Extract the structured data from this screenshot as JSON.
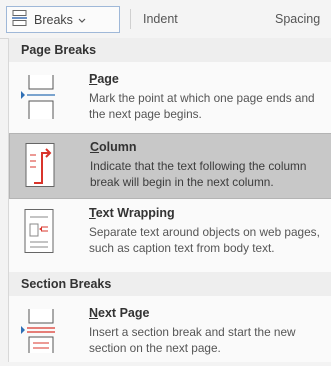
{
  "ribbon": {
    "breaks_label": "Breaks",
    "indent_label": "Indent",
    "spacing_label": "Spacing"
  },
  "menu": {
    "sections": [
      {
        "header": "Page Breaks",
        "items": [
          {
            "icon": "page-break-icon",
            "mnemonic": "P",
            "rest": "age",
            "description": "Mark the point at which one page ends and the next page begins.",
            "selected": false
          },
          {
            "icon": "column-break-icon",
            "mnemonic": "C",
            "rest": "olumn",
            "description": "Indicate that the text following the column break will begin in the next column.",
            "selected": true
          },
          {
            "icon": "text-wrapping-icon",
            "mnemonic": "T",
            "rest": "ext Wrapping",
            "description": "Separate text around objects on web pages, such as caption text from body text.",
            "selected": false
          }
        ]
      },
      {
        "header": "Section Breaks",
        "items": [
          {
            "icon": "next-page-section-icon",
            "mnemonic": "N",
            "rest": "ext Page",
            "description": "Insert a section break and start the new section on the next page.",
            "selected": false
          }
        ]
      }
    ]
  },
  "colors": {
    "accent": "#d9342b",
    "selected_bg": "#c8c8c8"
  }
}
